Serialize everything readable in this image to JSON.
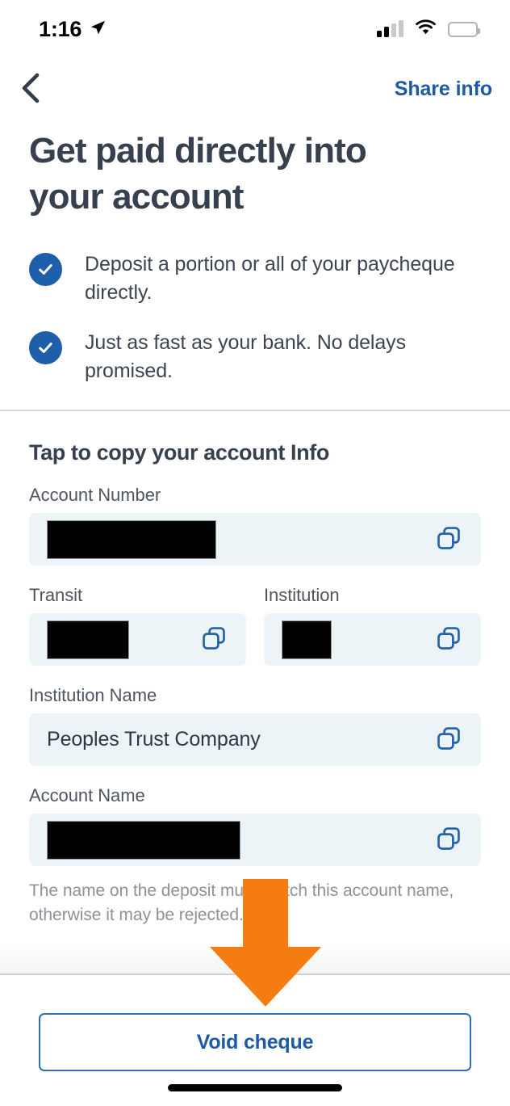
{
  "status_bar": {
    "time": "1:16",
    "location_icon": "location-arrow-icon",
    "signal_icon": "cellular-signal-icon",
    "wifi_icon": "wifi-icon",
    "battery_icon": "battery-icon",
    "battery_level_percent": 75,
    "signal_bars_active": 2,
    "signal_bars_total": 4
  },
  "nav": {
    "back_icon": "back-chevron-icon",
    "share_label": "Share info"
  },
  "hero": {
    "title": "Get paid directly into your account",
    "benefits": [
      {
        "icon": "check-circle-icon",
        "text": "Deposit a portion or all of your paycheque directly."
      },
      {
        "icon": "check-circle-icon",
        "text": "Just as fast as your bank. No delays promised."
      }
    ]
  },
  "account_section": {
    "title": "Tap to copy your account Info",
    "copy_icon": "copy-icon",
    "fields": [
      {
        "label": "Account Number",
        "value": "",
        "redacted": true,
        "redaction_width": 210
      },
      {
        "label": "Transit",
        "value": "",
        "redacted": true,
        "redaction_width": 102
      },
      {
        "label": "Institution",
        "value": "",
        "redacted": true,
        "redaction_width": 62
      },
      {
        "label": "Institution Name",
        "value": "Peoples Trust Company",
        "redacted": false,
        "redaction_width": 0
      },
      {
        "label": "Account Name",
        "value": "",
        "redacted": true,
        "redaction_width": 240
      }
    ],
    "helper_text": "The name on the deposit must match this account name, otherwise it may be rejected."
  },
  "bottom": {
    "void_cheque_label": "Void cheque",
    "home_indicator": "home-indicator"
  },
  "annotation": {
    "arrow_icon": "down-arrow-annotation",
    "color": "#f57c11"
  },
  "colors": {
    "accent_blue": "#1c5aa8",
    "button_border": "#2f6fb5",
    "check_blue": "#1f5ea8",
    "heading": "#37404f",
    "body_text": "#3d4451",
    "muted_text": "#8d919a",
    "field_bg": "#edf4f7",
    "divider": "#d3d4da",
    "annotation_orange": "#f57c11"
  }
}
